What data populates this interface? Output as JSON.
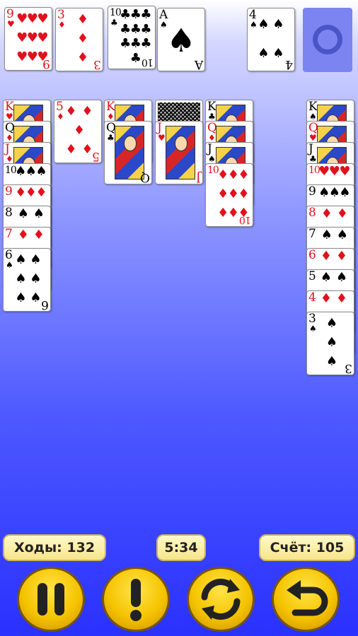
{
  "top_row": [
    {
      "rank": "9",
      "suit": "♥",
      "color": "red"
    },
    {
      "rank": "3",
      "suit": "♦",
      "color": "red"
    },
    {
      "rank": "10",
      "suit": "♣",
      "color": "black"
    },
    {
      "rank": "A",
      "suit": "♠",
      "color": "black"
    },
    {
      "rank": "4",
      "suit": "♠",
      "color": "black"
    }
  ],
  "columns": {
    "col1": [
      {
        "rank": "K",
        "suit": "♥"
      },
      {
        "rank": "Q",
        "suit": "♦"
      },
      {
        "rank": "J",
        "suit": "♦"
      },
      {
        "rank": "10",
        "suit": "♠"
      },
      {
        "rank": "9",
        "suit": "♦"
      },
      {
        "rank": "8",
        "suit": "♠"
      },
      {
        "rank": "7",
        "suit": "♦"
      },
      {
        "rank": "6",
        "suit": "♠"
      }
    ],
    "col2": [
      {
        "rank": "5",
        "suit": "♦"
      }
    ],
    "col3": [
      {
        "rank": "K",
        "suit": "♦"
      },
      {
        "rank": "Q",
        "suit": "♣"
      }
    ],
    "col4": [
      {
        "rank": "J",
        "suit": "♥"
      }
    ],
    "col5": [
      {
        "rank": "K",
        "suit": "♣"
      },
      {
        "rank": "Q",
        "suit": "♦"
      },
      {
        "rank": "J",
        "suit": "♠"
      },
      {
        "rank": "10",
        "suit": "♦"
      }
    ],
    "col7": [
      {
        "rank": "K",
        "suit": "♠"
      },
      {
        "rank": "Q",
        "suit": "♥"
      },
      {
        "rank": "J",
        "suit": "♣"
      },
      {
        "rank": "10",
        "suit": "♥"
      },
      {
        "rank": "9",
        "suit": "♠"
      },
      {
        "rank": "8",
        "suit": "♦"
      },
      {
        "rank": "7",
        "suit": "♠"
      },
      {
        "rank": "6",
        "suit": "♦"
      },
      {
        "rank": "5",
        "suit": "♠"
      },
      {
        "rank": "4",
        "suit": "♦"
      },
      {
        "rank": "3",
        "suit": "♠"
      }
    ]
  },
  "status": {
    "moves_label": "Ходы: 132",
    "timer": "5:34",
    "score_label": "Счёт: 105"
  },
  "controls": {
    "pause_icon": "pause-icon",
    "hint_icon": "exclamation-icon",
    "restart_icon": "refresh-icon",
    "undo_icon": "undo-icon"
  }
}
